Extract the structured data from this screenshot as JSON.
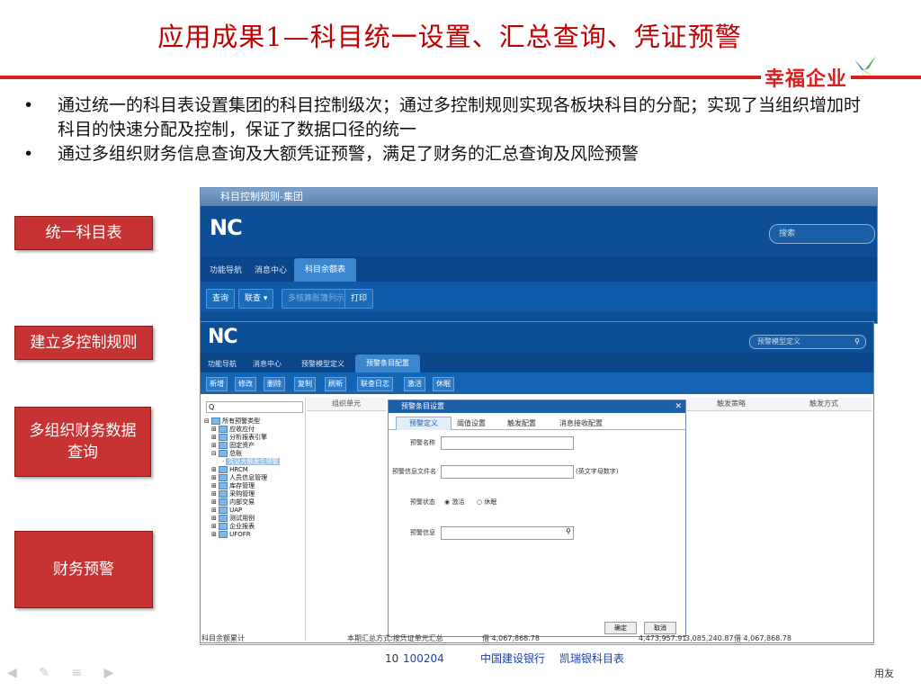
{
  "slide": {
    "title": "应用成果1—科目统一设置、汇总查询、凭证预警",
    "logo_text": "幸福企业",
    "bullets": [
      "通过统一的科目表设置集团的科目控制级次；通过多控制规则实现各板块科目的分配；实现了当组织增加时科目的快速分配及控制，保证了数据口径的统一",
      "通过多组织财务信息查询及大额凭证预警，满足了财务的汇总查询及风险预警"
    ],
    "side_buttons": [
      "统一科目表",
      "建立多控制规则",
      "多组织财务数据查询",
      "财务预警"
    ],
    "corner_text": "用友"
  },
  "window_back": {
    "title": "科目控制规则-集团",
    "nc_logo": "NC",
    "search_placeholder": "搜索",
    "tabs": [
      "功能导航",
      "消息中心",
      "科目余额表"
    ],
    "buttons": [
      "查询",
      "联查 ▾",
      "多核算账簿列示",
      "打印"
    ]
  },
  "window_front": {
    "nc_logo": "NC",
    "search_placeholder": "预警模型定义",
    "tabs": [
      "功能导航",
      "消息中心",
      "预警模型定义",
      "预警条目配置"
    ],
    "toolbar": [
      "新增",
      "修改",
      "删除",
      "复制",
      "刷新",
      "联查日志",
      "激活",
      "休眠"
    ],
    "tree_search": "Q",
    "tree": [
      "所有预警类型",
      "应收应付",
      "分析报表引擎",
      "固定资产",
      "总账",
      "凭证大额发生预警",
      "HRCM",
      "人员信息管理",
      "库存管理",
      "采购管理",
      "内部交易",
      "UAP",
      "测试用例",
      "企业报表",
      "UFOFR"
    ],
    "columns": [
      "组织单元",
      "触发策略",
      "触发方式"
    ],
    "dialog": {
      "title": "预警条目设置",
      "tabs": [
        "预警定义",
        "阈值设置",
        "触发配置",
        "消息接收配置"
      ],
      "fields": {
        "name_label": "预警名称",
        "file_label": "预警信息文件名",
        "file_hint": "(英文字母数字)",
        "status_label": "预警状态",
        "status_active": "激活",
        "status_sleep": "休眠",
        "info_label": "预警信息"
      },
      "ok": "确定",
      "cancel": "取消"
    }
  },
  "bottom_strip": {
    "row1": [
      "科目余额累计",
      "本期汇总方式:按凭证单元汇总",
      "借 4,067,868.78",
      "4,473,957.91",
      "3,085,240.87",
      "借 4,067,868.78"
    ],
    "row2": [
      "10",
      "100204",
      "中国建设银行",
      "凯瑞银科目表"
    ]
  }
}
